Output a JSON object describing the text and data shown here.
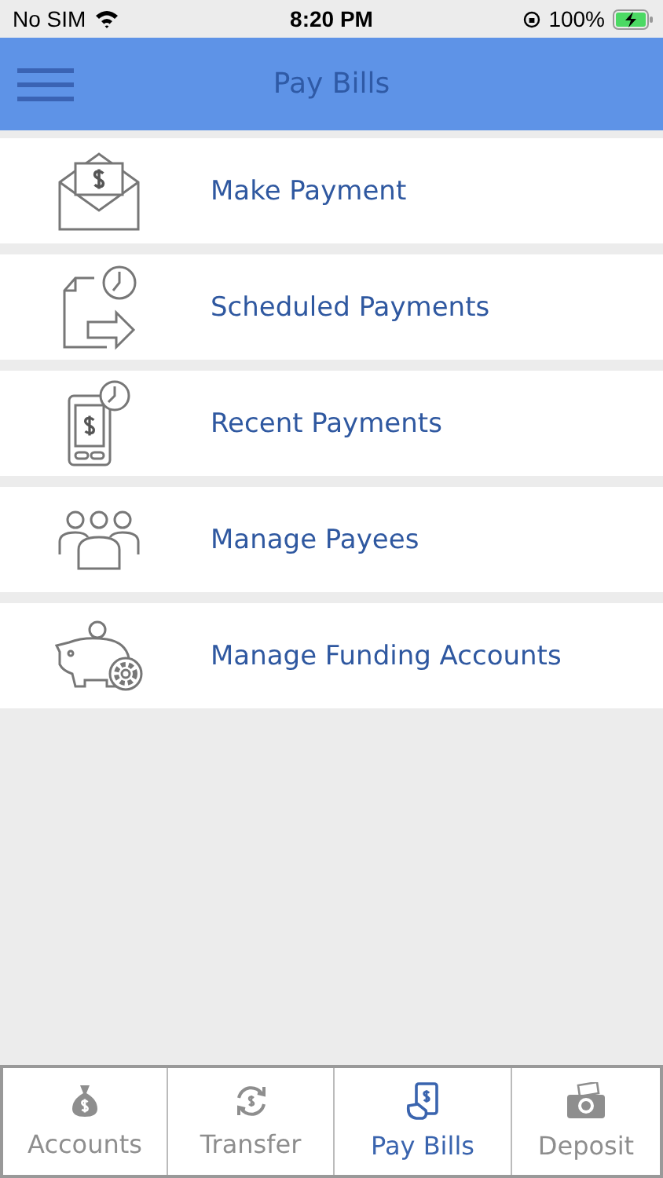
{
  "status_bar": {
    "carrier": "No SIM",
    "time": "8:20 PM",
    "battery": "100%"
  },
  "header": {
    "title": "Pay Bills"
  },
  "menu": [
    {
      "label": "Make Payment"
    },
    {
      "label": "Scheduled Payments"
    },
    {
      "label": "Recent Payments"
    },
    {
      "label": "Manage Payees"
    },
    {
      "label": "Manage Funding Accounts"
    }
  ],
  "tabs": [
    {
      "label": "Accounts",
      "selected": false
    },
    {
      "label": "Transfer",
      "selected": false
    },
    {
      "label": "Pay Bills",
      "selected": true
    },
    {
      "label": "Deposit",
      "selected": false
    }
  ]
}
